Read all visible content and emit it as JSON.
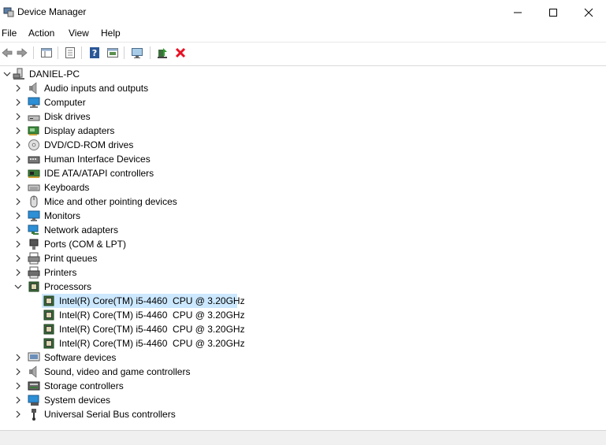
{
  "window": {
    "title": "Device Manager"
  },
  "menu": [
    "File",
    "Action",
    "View",
    "Help"
  ],
  "toolbar": [
    "back-arrow-icon",
    "forward-arrow-icon",
    "properties-pane-icon",
    "details-icon",
    "help-icon",
    "view-icon",
    "monitor-scan-icon",
    "update-driver-icon",
    "uninstall-x-icon"
  ],
  "tree": {
    "root": "DANIEL-PC",
    "categories": [
      {
        "label": "Audio inputs and outputs",
        "icon": "speaker-icon"
      },
      {
        "label": "Computer",
        "icon": "computer-icon"
      },
      {
        "label": "Disk drives",
        "icon": "disk-drive-icon"
      },
      {
        "label": "Display adapters",
        "icon": "display-adapter-icon"
      },
      {
        "label": "DVD/CD-ROM drives",
        "icon": "dvd-icon"
      },
      {
        "label": "Human Interface Devices",
        "icon": "hid-icon"
      },
      {
        "label": "IDE ATA/ATAPI controllers",
        "icon": "ide-controller-icon"
      },
      {
        "label": "Keyboards",
        "icon": "keyboard-icon"
      },
      {
        "label": "Mice and other pointing devices",
        "icon": "mouse-icon"
      },
      {
        "label": "Monitors",
        "icon": "monitor-icon"
      },
      {
        "label": "Network adapters",
        "icon": "network-adapter-icon"
      },
      {
        "label": "Ports (COM & LPT)",
        "icon": "port-icon"
      },
      {
        "label": "Print queues",
        "icon": "print-queue-icon"
      },
      {
        "label": "Printers",
        "icon": "printer-icon"
      },
      {
        "label": "Processors",
        "icon": "processor-icon",
        "expanded": true,
        "children": [
          "Intel(R) Core(TM) i5-4460  CPU @ 3.20GHz",
          "Intel(R) Core(TM) i5-4460  CPU @ 3.20GHz",
          "Intel(R) Core(TM) i5-4460  CPU @ 3.20GHz",
          "Intel(R) Core(TM) i5-4460  CPU @ 3.20GHz"
        ]
      },
      {
        "label": "Software devices",
        "icon": "software-device-icon"
      },
      {
        "label": "Sound, video and game controllers",
        "icon": "sound-controller-icon"
      },
      {
        "label": "Storage controllers",
        "icon": "storage-controller-icon"
      },
      {
        "label": "System devices",
        "icon": "system-device-icon"
      },
      {
        "label": "Universal Serial Bus controllers",
        "icon": "usb-icon"
      }
    ]
  },
  "colors": {
    "selection": "#cce8ff",
    "uninstall": "#e81123",
    "help": "#2b5797"
  }
}
